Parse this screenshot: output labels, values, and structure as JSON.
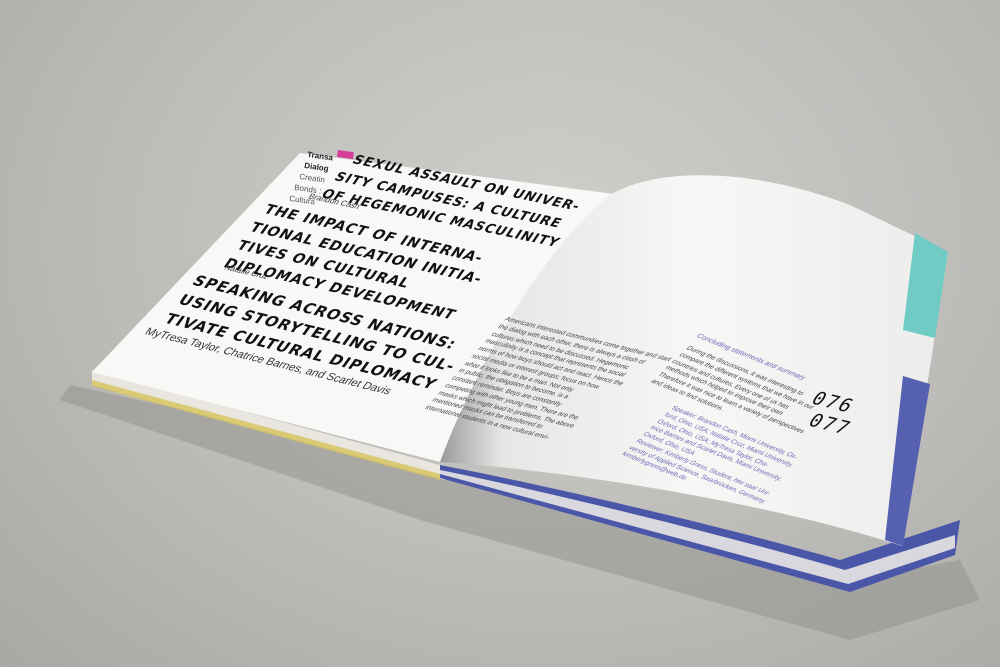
{
  "left_page": {
    "running_head": {
      "line1": "Transa",
      "line2": "Dialog",
      "line3": "Creatin",
      "line4": "Bonds :",
      "line5": "Cultura"
    },
    "articles": [
      {
        "title_lines": [
          "SEXUL ASSAULT ON UNIVER-",
          "SITY CAMPUSES: A CULTURE",
          "OF HEGEMONIC MASCULINITY"
        ],
        "author": "Brandon Cash"
      },
      {
        "title_lines": [
          "THE IMPACT OF INTERNA-",
          "TIONAL EDUCATION INITIA-",
          "TIVES ON CULTURAL",
          "DIPLOMACY DEVELOPMENT"
        ],
        "author": "Natalie Cruz"
      },
      {
        "title_lines": [
          "SPEAKING ACROSS NATIONS:",
          "USING STORYTELLING TO CUL-",
          "TIVATE CULTURAL DIPLOMACY"
        ],
        "author": "MyTresa Taylor, Chatrice Barnes, and Scarlet Davis"
      }
    ]
  },
  "right_page": {
    "folio_left": "076",
    "folio_right": "077",
    "body_lines": [
      "Americans interested communities come together and start",
      "the dialog with each other, there is always a clash of",
      "cultures which need to be discussed. Hegemonic",
      "masculinity is a concept that represents the social",
      "norms of how boys should act and react. Hence the",
      "social media or interest groups; focus on how",
      "what it looks like to be a man. Not only",
      "in public, the obligation to become, is a",
      "constant reminder. Boys are constantly",
      "competing with other young men. There are the",
      "masks which might lead to problems. The above",
      "mentioned masks can be transferred to",
      "international students in a new cultural envi-"
    ],
    "section_head": "Concluding statements and summary",
    "summary_lines": [
      "During the discussions, it was interesting to",
      "compare the different systems that we have in our",
      "countries and cultures. Every one of us has",
      "methods which helped to improve their own",
      "Therefore it was nice to learn a variety of perspectives",
      "and ideas to find solutions."
    ],
    "credits_lines": [
      "Speaker: Brandon Cash, Miami University, Ox-",
      "ford, Ohio, USA; Natalie Cruz, Miami University,",
      "Oxford, Ohio, USA; MyTresa Taylor, Cha-",
      "trice Barnes and Scarlet Davis, Miami University,",
      "Oxford, Ohio, USA",
      "Reviewer: Kimberly Gress, Student, htw saar Uni-",
      "versity of Applied Science, Saarbrücken, Germany,",
      "kimberlygress@web.de"
    ]
  },
  "colors": {
    "background": "#bdbcb9",
    "paper": "#f7f7f5",
    "teal_band": "#6fcbc4",
    "blue_band": "#5560b0",
    "magenta_mark": "#d63b9a"
  }
}
